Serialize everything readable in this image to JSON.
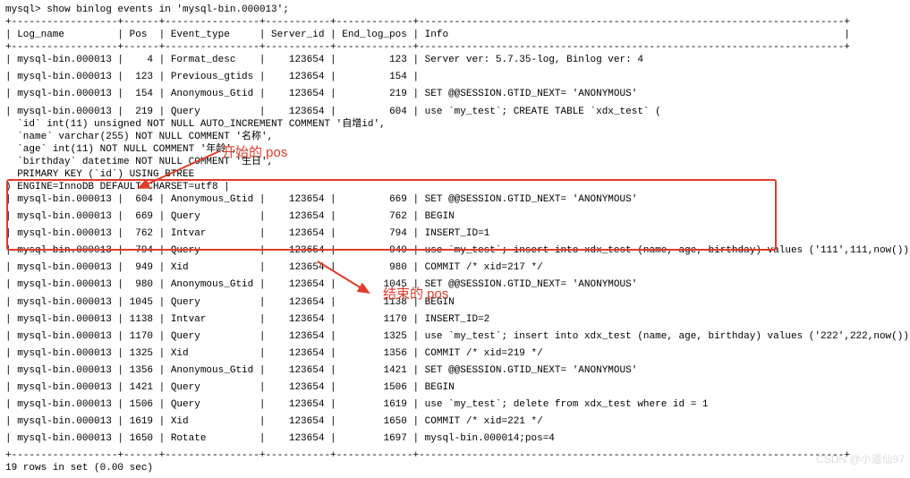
{
  "prompt": "mysql> show binlog events in 'mysql-bin.000013';",
  "border_top": "+------------------+------+----------------+-----------+-------------+------------------------------------------------------------------------+",
  "border_mid": "+------------------+------+----------------+-----------+-------------+------------------------------------------------------------------------+",
  "border_bot": "+------------------+------+----------------+-----------+-------------+------------------------------------------------------------------------+",
  "header_row": "| Log_name         | Pos  | Event_type     | Server_id | End_log_pos | Info                                                                   |",
  "footer": "19 rows in set (0.00 sec)",
  "annotations": {
    "start_pos_label": "开始的 pos",
    "end_pos_label": "结束的 pos"
  },
  "rows": [
    {
      "log": "mysql-bin.000013",
      "pos": "4",
      "etype": "Format_desc",
      "sid": "123654",
      "end": "123",
      "info": "Server ver: 5.7.35-log, Binlog ver: 4"
    },
    {
      "log": "mysql-bin.000013",
      "pos": "123",
      "etype": "Previous_gtids",
      "sid": "123654",
      "end": "154",
      "info": ""
    },
    {
      "log": "mysql-bin.000013",
      "pos": "154",
      "etype": "Anonymous_Gtid",
      "sid": "123654",
      "end": "219",
      "info": "SET @@SESSION.GTID_NEXT= 'ANONYMOUS'"
    },
    {
      "log": "mysql-bin.000013",
      "pos": "219",
      "etype": "Query",
      "sid": "123654",
      "end": "604",
      "info": "use `my_test`; CREATE TABLE `xdx_test` (",
      "multi": [
        "  `id` int(11) unsigned NOT NULL AUTO_INCREMENT COMMENT '自增id',",
        "  `name` varchar(255) NOT NULL COMMENT '名称',",
        "  `age` int(11) NOT NULL COMMENT '年龄',",
        "  `birthday` datetime NOT NULL COMMENT '生日',",
        "  PRIMARY KEY (`id`) USING BTREE",
        ") ENGINE=InnoDB DEFAULT CHARSET=utf8 |"
      ]
    },
    {
      "log": "mysql-bin.000013",
      "pos": "604",
      "etype": "Anonymous_Gtid",
      "sid": "123654",
      "end": "669",
      "info": "SET @@SESSION.GTID_NEXT= 'ANONYMOUS'"
    },
    {
      "log": "mysql-bin.000013",
      "pos": "669",
      "etype": "Query",
      "sid": "123654",
      "end": "762",
      "info": "BEGIN"
    },
    {
      "log": "mysql-bin.000013",
      "pos": "762",
      "etype": "Intvar",
      "sid": "123654",
      "end": "794",
      "info": "INSERT_ID=1"
    },
    {
      "log": "mysql-bin.000013",
      "pos": "794",
      "etype": "Query",
      "sid": "123654",
      "end": "949",
      "info": "use `my_test`; insert into xdx_test (name, age, birthday) values ('111',111,now())"
    },
    {
      "log": "mysql-bin.000013",
      "pos": "949",
      "etype": "Xid",
      "sid": "123654",
      "end": "980",
      "info": "COMMIT /* xid=217 */"
    },
    {
      "log": "mysql-bin.000013",
      "pos": "980",
      "etype": "Anonymous_Gtid",
      "sid": "123654",
      "end": "1045",
      "info": "SET @@SESSION.GTID_NEXT= 'ANONYMOUS'"
    },
    {
      "log": "mysql-bin.000013",
      "pos": "1045",
      "etype": "Query",
      "sid": "123654",
      "end": "1138",
      "info": "BEGIN"
    },
    {
      "log": "mysql-bin.000013",
      "pos": "1138",
      "etype": "Intvar",
      "sid": "123654",
      "end": "1170",
      "info": "INSERT_ID=2"
    },
    {
      "log": "mysql-bin.000013",
      "pos": "1170",
      "etype": "Query",
      "sid": "123654",
      "end": "1325",
      "info": "use `my_test`; insert into xdx_test (name, age, birthday) values ('222',222,now())"
    },
    {
      "log": "mysql-bin.000013",
      "pos": "1325",
      "etype": "Xid",
      "sid": "123654",
      "end": "1356",
      "info": "COMMIT /* xid=219 */"
    },
    {
      "log": "mysql-bin.000013",
      "pos": "1356",
      "etype": "Anonymous_Gtid",
      "sid": "123654",
      "end": "1421",
      "info": "SET @@SESSION.GTID_NEXT= 'ANONYMOUS'"
    },
    {
      "log": "mysql-bin.000013",
      "pos": "1421",
      "etype": "Query",
      "sid": "123654",
      "end": "1506",
      "info": "BEGIN"
    },
    {
      "log": "mysql-bin.000013",
      "pos": "1506",
      "etype": "Query",
      "sid": "123654",
      "end": "1619",
      "info": "use `my_test`; delete from xdx_test where id = 1"
    },
    {
      "log": "mysql-bin.000013",
      "pos": "1619",
      "etype": "Xid",
      "sid": "123654",
      "end": "1650",
      "info": "COMMIT /* xid=221 */"
    },
    {
      "log": "mysql-bin.000013",
      "pos": "1650",
      "etype": "Rotate",
      "sid": "123654",
      "end": "1697",
      "info": "mysql-bin.000014;pos=4"
    }
  ],
  "watermark": "CSDN @小道仙97"
}
